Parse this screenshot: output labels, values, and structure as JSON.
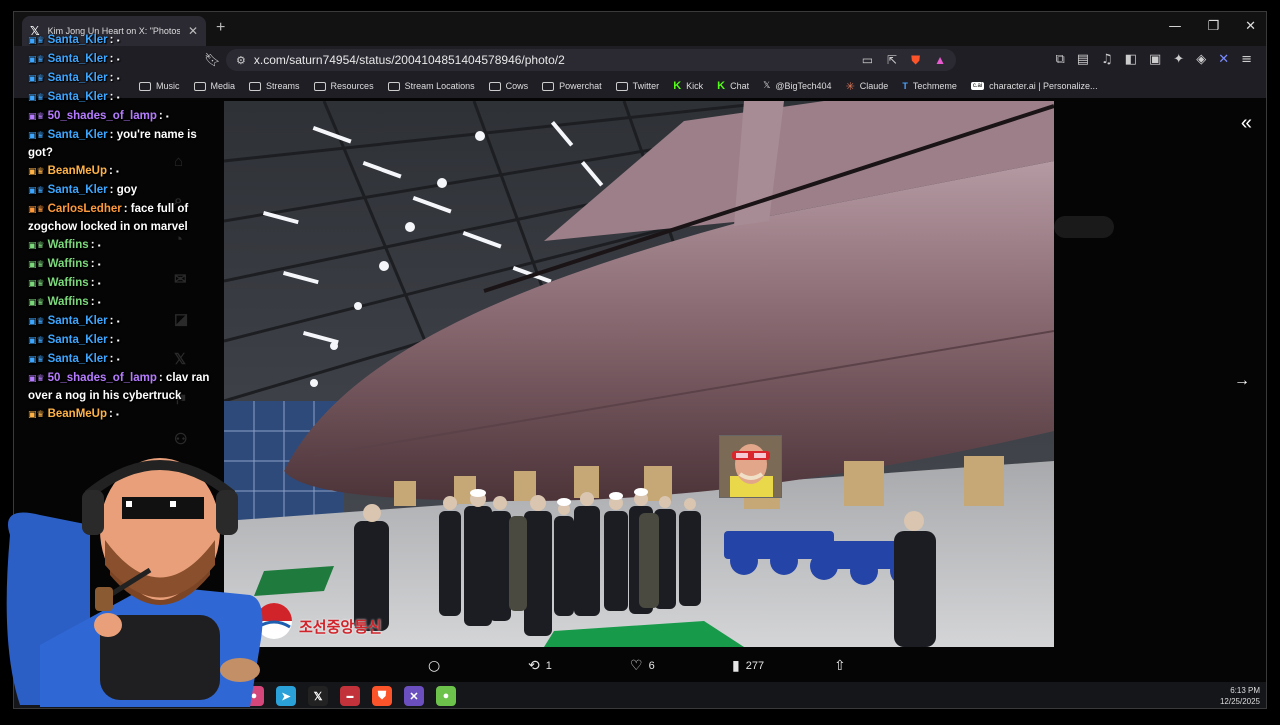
{
  "tab": {
    "title": "Kim Jong Un Heart on X: \"Photos of the conv",
    "close": "✕"
  },
  "window": {
    "minimize": "—",
    "maximize": "❐",
    "close": "✕",
    "new_tab": "+"
  },
  "address": {
    "url": "x.com/saturn74954/status/2004104851404578946/photo/2"
  },
  "bookmarks": [
    {
      "label": "Music",
      "icon": "folder-icon"
    },
    {
      "label": "Media",
      "icon": "folder-icon"
    },
    {
      "label": "Streams",
      "icon": "folder-icon"
    },
    {
      "label": "Resources",
      "icon": "folder-icon"
    },
    {
      "label": "Stream Locations",
      "icon": "folder-icon"
    },
    {
      "label": "Cows",
      "icon": "folder-icon"
    },
    {
      "label": "Powerchat",
      "icon": "folder-icon"
    },
    {
      "label": "Twitter",
      "icon": "folder-icon"
    },
    {
      "label": "Kick",
      "icon": "kick-icon"
    },
    {
      "label": "Chat",
      "icon": "kick-icon"
    },
    {
      "label": "@BigTech404",
      "icon": "x-icon"
    },
    {
      "label": "Claude",
      "icon": "claude-icon"
    },
    {
      "label": "Techmeme",
      "icon": "techmeme-icon"
    },
    {
      "label": "character.ai | Personalize...",
      "icon": "characterai-icon"
    }
  ],
  "chat": [
    {
      "user": "Santa_Kler",
      "color": "#3ea6ff",
      "text": ""
    },
    {
      "user": "Santa_Kler",
      "color": "#3ea6ff",
      "text": ""
    },
    {
      "user": "Santa_Kler",
      "color": "#3ea6ff",
      "text": ""
    },
    {
      "user": "Santa_Kler",
      "color": "#3ea6ff",
      "text": ""
    },
    {
      "user": "50_shades_of_lamp",
      "color": "#b67cff",
      "text": ""
    },
    {
      "user": "Santa_Kler",
      "color": "#3ea6ff",
      "text": "you're name is got?"
    },
    {
      "user": "BeanMeUp",
      "color": "#ffb347",
      "text": ""
    },
    {
      "user": "Santa_Kler",
      "color": "#3ea6ff",
      "text": "goy"
    },
    {
      "user": "CarlosLedher",
      "color": "#ff9a3c",
      "text": "face full of zogchow locked in on marvel"
    },
    {
      "user": "Waffins",
      "color": "#7bd87b",
      "text": ""
    },
    {
      "user": "Waffins",
      "color": "#7bd87b",
      "text": ""
    },
    {
      "user": "Waffins",
      "color": "#7bd87b",
      "text": ""
    },
    {
      "user": "Waffins",
      "color": "#7bd87b",
      "text": ""
    },
    {
      "user": "Santa_Kler",
      "color": "#3ea6ff",
      "text": ""
    },
    {
      "user": "Santa_Kler",
      "color": "#3ea6ff",
      "text": ""
    },
    {
      "user": "Santa_Kler",
      "color": "#3ea6ff",
      "text": ""
    },
    {
      "user": "50_shades_of_lamp",
      "color": "#b67cff",
      "text": "clav ran over a nog in his cybertruck"
    },
    {
      "user": "BeanMeUp",
      "color": "#ffb347",
      "text": ""
    }
  ],
  "photo": {
    "watermark": "조선중앙통신"
  },
  "actions": {
    "replies": "",
    "reposts": "1",
    "likes": "6",
    "views": "277"
  },
  "taskbar": {
    "time": "6:13 PM",
    "date": "12/25/2025"
  },
  "colors": {
    "accent_blue": "#1d9bf0",
    "hull": "#8a6a72",
    "kick_green": "#53fc18"
  }
}
